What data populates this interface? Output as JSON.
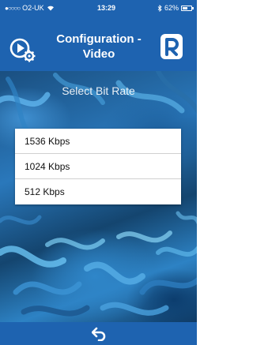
{
  "status_bar": {
    "signal_dots": "●○○○○",
    "carrier": "O2-UK",
    "time": "13:29",
    "battery": "62%",
    "battery_level": 0.62
  },
  "header": {
    "title_line1": "Configuration -",
    "title_line2": "Video",
    "left_icon": "video-settings-icon",
    "right_icon": "logo-icon"
  },
  "main": {
    "section_title": "Select Bit Rate",
    "options": [
      {
        "label": "1536 Kbps"
      },
      {
        "label": "1024 Kbps"
      },
      {
        "label": "512 Kbps"
      }
    ]
  },
  "footer": {
    "back_icon": "back-arrow-icon"
  },
  "colors": {
    "primary": "#1e63b0",
    "list_bg": "#ffffff",
    "text": "#111111"
  }
}
